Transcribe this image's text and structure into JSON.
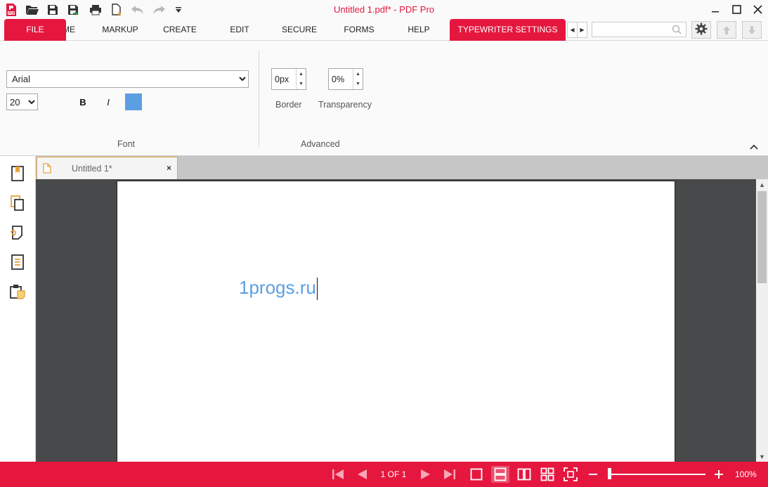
{
  "window": {
    "title": "Untitled 1.pdf* - PDF Pro"
  },
  "menu": {
    "file": "FILE",
    "tabs": [
      "HOME",
      "MARKUP",
      "CREATE",
      "EDIT",
      "SECURE",
      "FORMS",
      "HELP"
    ],
    "active_tab": "TYPEWRITER SETTINGS"
  },
  "search": {
    "value": "",
    "placeholder": ""
  },
  "ribbon": {
    "font": {
      "family": "Arial",
      "family_options": [
        "Arial"
      ],
      "size": "20",
      "size_options": [
        "20"
      ],
      "bold_label": "B",
      "italic_label": "I",
      "color": "#5b9fe3",
      "group_label": "Font"
    },
    "advanced": {
      "border_value": "0px",
      "border_label": "Border",
      "transparency_value": "0%",
      "transparency_label": "Transparency",
      "group_label": "Advanced"
    }
  },
  "document": {
    "tab_label": "Untitled 1*",
    "close_glyph": "×",
    "typed_text": "1progs.ru"
  },
  "status": {
    "page_indicator": "1 OF 1",
    "zoom": "100%",
    "zoom_level_fraction": 0.0
  },
  "colors": {
    "accent": "#e5173f",
    "text_color": "#5b9fe3",
    "canvas": "#48494b"
  },
  "icons": [
    "app-logo-icon",
    "open-icon",
    "save-icon",
    "save-as-icon",
    "print-icon",
    "new-icon",
    "undo-icon",
    "redo-icon",
    "customize-icon",
    "minimize-icon",
    "maximize-icon",
    "close-icon",
    "search-icon",
    "gear-icon",
    "arrow-up-icon",
    "arrow-down-icon",
    "bookmark-icon",
    "pages-icon",
    "attachments-icon",
    "document-list-icon",
    "clipboard-icon",
    "file-icon",
    "first-page-icon",
    "prev-page-icon",
    "next-page-icon",
    "last-page-icon",
    "single-page-icon",
    "continuous-icon",
    "two-page-icon",
    "grid-icon",
    "fit-icon",
    "zoom-out-icon",
    "zoom-in-icon"
  ]
}
